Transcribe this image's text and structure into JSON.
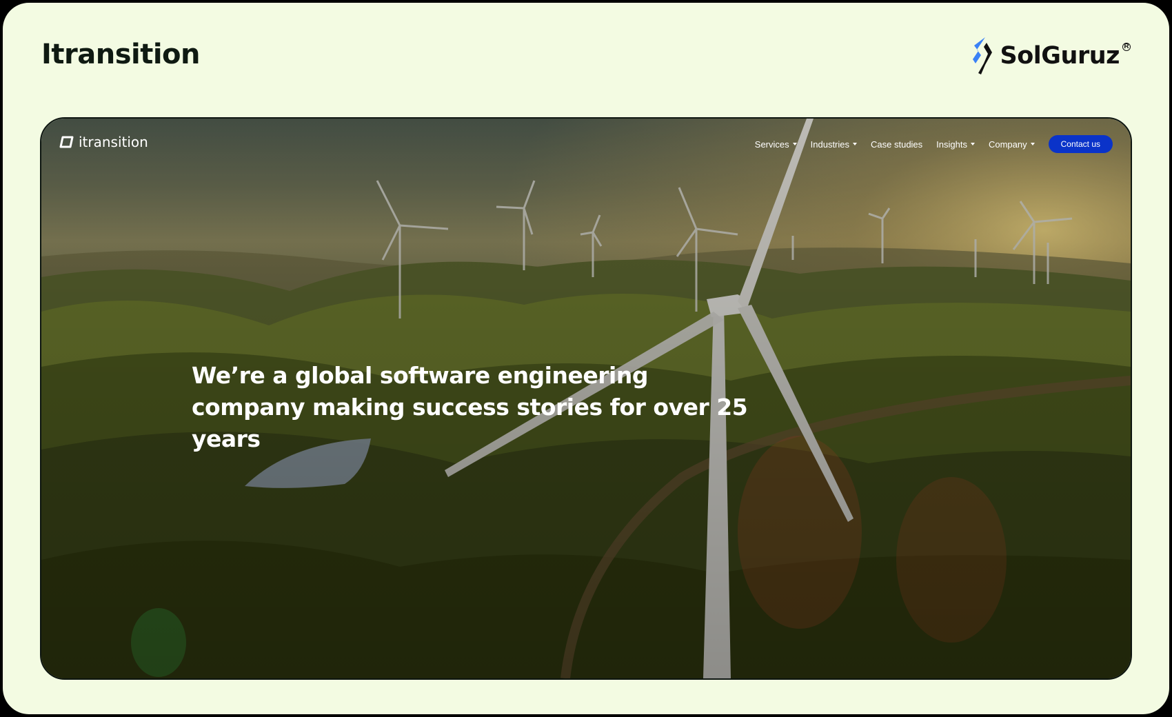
{
  "page": {
    "title": "Itransition"
  },
  "brand": {
    "name": "SolGuruz",
    "registered_mark": "R",
    "icon": "solguruz-logo-icon"
  },
  "site": {
    "logo_text": "itransition",
    "logo_icon": "itransition-logo-icon",
    "nav": {
      "services": "Services",
      "industries": "Industries",
      "case_studies": "Case studies",
      "insights": "Insights",
      "company": "Company",
      "contact": "Contact us"
    },
    "hero": {
      "headline": "We’re a global software engineering company making success stories for over 25 years"
    }
  },
  "colors": {
    "background": "#f3fbe2",
    "contact_button": "#0a33c9",
    "brand_accent": "#3b82f6"
  }
}
